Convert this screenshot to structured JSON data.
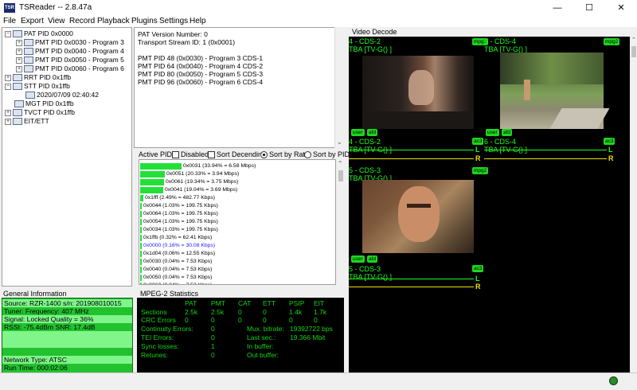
{
  "window": {
    "title": "TSReader -- 2.8.47a",
    "app_icon_text": "TSR",
    "minimize": "—",
    "maximize": "☐",
    "close": "✕"
  },
  "menu": [
    "File",
    "Export",
    "View",
    "Record",
    "Playback",
    "Plugins",
    "Settings",
    "Help"
  ],
  "tree": [
    {
      "label": "PAT PID 0x0000",
      "expander": "−"
    },
    {
      "label": "PMT PID 0x0030 - Program 3",
      "expander": "+"
    },
    {
      "label": "PMT PID 0x0040 - Program 4",
      "expander": "+"
    },
    {
      "label": "PMT PID 0x0050 - Program 5",
      "expander": "+"
    },
    {
      "label": "PMT PID 0x0060 - Program 6",
      "expander": "+"
    },
    {
      "label": "RRT PID 0x1ffb",
      "expander": "+"
    },
    {
      "label": "STT PID 0x1ffb",
      "expander": "−"
    },
    {
      "label": "2020/07/09 02:40:42",
      "expander": ""
    },
    {
      "label": "MGT PID 0x1ffb",
      "expander": ""
    },
    {
      "label": "TVCT PID 0x1ffb",
      "expander": "+"
    },
    {
      "label": "EIT/ETT",
      "expander": "+"
    }
  ],
  "pat_info": [
    "PAT Version Number: 0",
    "Transport Stream ID: 1 (0x0001)",
    "",
    "PMT PID 48 (0x0030) - Program 3 CDS-1",
    "PMT PID 64 (0x0040) - Program 4 CDS-2",
    "PMT PID 80 (0x0050) - Program 5 CDS-3",
    "PMT PID 96 (0x0060) - Program 6 CDS-4"
  ],
  "active_pids": {
    "label": "Active PIDs",
    "disabled_label": "Disabled",
    "sort_descending_label": "Sort Decending",
    "sort_rate_label": "Sort by Rate",
    "sort_pid_label": "Sort by PID",
    "rows": [
      {
        "text": "0x0031 (33.94% = 6.58 Mbps)",
        "percent": 33.94,
        "color": "#000000"
      },
      {
        "text": "0x0051 (20.33% = 3.94 Mbps)",
        "percent": 20.33,
        "color": "#000000"
      },
      {
        "text": "0x0061 (19.34% = 3.75 Mbps)",
        "percent": 19.34,
        "color": "#000000"
      },
      {
        "text": "0x0041 (19.04% = 3.69 Mbps)",
        "percent": 19.04,
        "color": "#000000"
      },
      {
        "text": "0x1fff (2.49% = 482.77 Kbps)",
        "percent": 2.49,
        "color": "#000000"
      },
      {
        "text": "0x0044 (1.03% = 199.75 Kbps)",
        "percent": 1.03,
        "color": "#000000"
      },
      {
        "text": "0x0064 (1.03% = 199.75 Kbps)",
        "percent": 1.03,
        "color": "#000000"
      },
      {
        "text": "0x0054 (1.03% = 199.75 Kbps)",
        "percent": 1.03,
        "color": "#000000"
      },
      {
        "text": "0x0034 (1.03% = 199.75 Kbps)",
        "percent": 1.03,
        "color": "#000000"
      },
      {
        "text": "0x1ffb (0.32% = 62.41 Kbps)",
        "percent": 0.32,
        "color": "#000000"
      },
      {
        "text": "0x0000 (0.16% = 30.08 Kbps)",
        "percent": 0.16,
        "color": "#1a1aff"
      },
      {
        "text": "0x1d04 (0.06% = 12.55 Kbps)",
        "percent": 0.06,
        "color": "#000000"
      },
      {
        "text": "0x0030 (0.04% = 7.53 Kbps)",
        "percent": 0.04,
        "color": "#000000"
      },
      {
        "text": "0x0040 (0.04% = 7.53 Kbps)",
        "percent": 0.04,
        "color": "#000000"
      },
      {
        "text": "0x0050 (0.04% = 7.53 Kbps)",
        "percent": 0.04,
        "color": "#000000"
      },
      {
        "text": "0x0060 (0.04% = 7.52 Kbps)",
        "percent": 0.04,
        "color": "#000000"
      }
    ]
  },
  "video_decode": {
    "label": "Video Decode",
    "tiles": [
      {
        "title": "4 - CDS-2",
        "rating": "TBA [TV-G() ]",
        "codec": "mpg2",
        "btn_user": "user",
        "btn_afd": "afd",
        "scene": "dark"
      },
      {
        "title": "6 - CDS-4",
        "rating": "TBA [TV-G() ]",
        "codec": "mpg2",
        "btn_user": "user",
        "btn_afd": "afd",
        "scene": "forest"
      },
      {
        "title": "5 - CDS-3",
        "rating": "TBA [TV-G() ]",
        "codec": "mpg2",
        "btn_user": "user",
        "btn_afd": "afd",
        "scene": "face"
      }
    ],
    "audio": [
      {
        "title": "4 - CDS-2",
        "rating": "TBA [TV-G() ]",
        "codec": "ac3",
        "left": "L",
        "right": "R"
      },
      {
        "title": "6 - CDS-4",
        "rating": "TBA [TV-G() ]",
        "codec": "ac3",
        "left": "L",
        "right": "R"
      },
      {
        "title": "5 - CDS-3",
        "rating": "TBA [TV-G() ]",
        "codec": "ac3",
        "left": "L",
        "right": "R"
      }
    ]
  },
  "general_info": {
    "label": "General Information",
    "rows": [
      "Source: RZR-1400 s/n: 201908010015",
      "Tuner: Frequency: 407 MHz",
      "Signal: Locked Quality = 36%",
      "RSSI: -75.4dBm SNR: 17.4dB",
      "",
      "",
      "",
      "Network Type: ATSC",
      "Run Time: 000:02:06"
    ]
  },
  "mpeg2_stats": {
    "label": "MPEG-2 Statistics",
    "columns": [
      "PAT",
      "PMT",
      "CAT",
      "ETT",
      "PSIP",
      "EIT"
    ],
    "sections": {
      "label": "Sections",
      "values": [
        "2.5k",
        "2.5k",
        "0",
        "0",
        "1.4k",
        "1.7k"
      ]
    },
    "crc_errors": {
      "label": "CRC Errors",
      "values": [
        "0",
        "0",
        "0",
        "0",
        "0",
        "0"
      ]
    },
    "continuity_errors": {
      "label": "Continuity Errors:",
      "value": "0"
    },
    "tei_errors": {
      "label": "TEI Errors:",
      "value": "0"
    },
    "sync_losses": {
      "label": "Sync losses:",
      "value": "1"
    },
    "retunes": {
      "label": "Retunes:",
      "value": "0"
    },
    "mux_bitrate": {
      "label": "Mux. bitrate:",
      "value": "19392722 bps"
    },
    "last_sec": {
      "label": "Last sec.:",
      "value": "19.366 Mbit"
    },
    "in_buffer": {
      "label": "In buffer:",
      "value": ""
    },
    "out_buffer": {
      "label": "Out buffer:",
      "value": ""
    }
  }
}
